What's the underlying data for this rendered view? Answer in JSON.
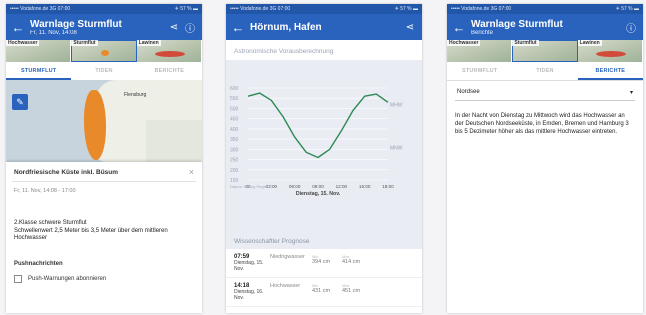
{
  "status": {
    "left": "••••• Vodafone.de  3G  07:00",
    "right": "✈ 57 % ▬"
  },
  "panel1": {
    "title": "Warnlage Sturmflut",
    "subtitle": "Fr, 11. Nov, 14:08",
    "thumbs": [
      "Hochwasser",
      "Sturmflut",
      "Lawinen"
    ],
    "tabs": [
      "STURMFLUT",
      "TIDEN",
      "BERICHTE"
    ],
    "map_town": "Flensburg",
    "popup": {
      "title": "Nordfriesische Küste inkl. Büsum",
      "close": "×",
      "time": "Fr, 11. Nov, 14:08 - 17:00",
      "text": "2.Klasse  schwere Sturmflut\nSchwellenwert 2,5 Meter bis 3,5 Meter über dem mittleren Hochwasser",
      "push_heading": "Pushnachrichten",
      "push_option": "Push-Warnungen abonnieren"
    }
  },
  "panel2": {
    "title": "Hörnum, Hafen",
    "section1": "Astronomische Vorausberechnung",
    "section2": "Wissenschaftler Prognose",
    "forecast": [
      {
        "time": "07:59",
        "date": "Dienstag, 15. Nov.",
        "kind": "Niedrigwasser",
        "v1_label": "Min",
        "v1": "394 cm",
        "v2_label": "Max",
        "v2": "414 cm"
      },
      {
        "time": "14:18",
        "date": "Dienstag, 16. Nov.",
        "kind": "Hochwasser",
        "v1_label": "Min",
        "v1": "431 cm",
        "v2_label": "Max",
        "v2": "451 cm"
      }
    ]
  },
  "panel3": {
    "title": "Warnlage Sturmflut",
    "subtitle": "Berichte",
    "thumbs": [
      "Hochwasser",
      "Sturmflut",
      "Lawinen"
    ],
    "tabs": [
      "STURMFLUT",
      "TIDEN",
      "BERICHTE"
    ],
    "region": "Nordsee",
    "report": "In der Nacht von Dienstag zu Mittwoch wird das Hochwasser an der Deutschen Nordseeküste, in Emden, Bremen und Hamburg 3 bis 5 Dezimeter höher als das mittlere Hochwasser eintreten."
  },
  "chart_data": {
    "type": "line",
    "yticks": [
      "600",
      "550",
      "500",
      "450",
      "400",
      "350",
      "300",
      "250",
      "200",
      "150"
    ],
    "ylim": [
      150,
      600
    ],
    "xticks": [
      "00",
      "03:00",
      "06:00",
      "09:00",
      "12:00",
      "15:00",
      "18:00"
    ],
    "xlabel": "Dienstag, 15. Nov.",
    "side_labels": [
      "MHW",
      "MNW"
    ],
    "left_note": "Datum: Bezug Pegel",
    "series": [
      {
        "x": [
          0,
          1.5,
          3,
          4.5,
          6,
          7.5,
          9,
          10.5,
          12,
          13.5,
          15,
          16.5,
          18
        ],
        "values": [
          560,
          575,
          540,
          460,
          360,
          285,
          260,
          300,
          390,
          490,
          560,
          570,
          530
        ]
      }
    ],
    "colors": {
      "line": "#2e8a55"
    }
  }
}
